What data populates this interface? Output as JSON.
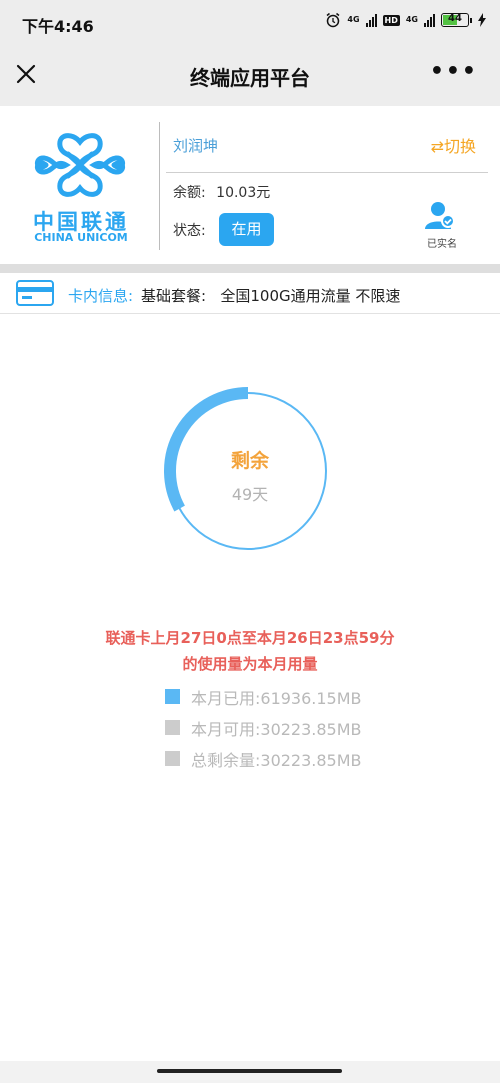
{
  "status_bar": {
    "time": "下午4:46",
    "network_1": "4G",
    "network_2": "HD",
    "network_3": "4G",
    "battery": "44"
  },
  "nav": {
    "title": "终端应用平台",
    "close_icon": "close-icon",
    "more_icon": "more-icon"
  },
  "account": {
    "logo_text_cn": "中国联通",
    "logo_text_en": "CHINA UNICOM",
    "name": "刘润坤",
    "switch_label": "⇄切换",
    "balance_label": "余额:",
    "balance_value": "10.03元",
    "status_label": "状态:",
    "status_value": "在用",
    "verified_label": "已实名"
  },
  "card_info": {
    "label": "卡内信息:",
    "value": "基础套餐:   全国100G通用流量 不限速"
  },
  "usage": {
    "ring_title": "剩余",
    "ring_days": "49天",
    "remaining_fraction": 0.33,
    "note_line1": "联通卡上月27日0点至本月26日23点59分",
    "note_line2": "的使用量为本月用量",
    "legend": [
      {
        "text": "本月已用:61936.15MB",
        "color": "#5ab8f4"
      },
      {
        "text": "本月可用:30223.85MB",
        "color": "#cccccc"
      },
      {
        "text": "总剩余量:30223.85MB",
        "color": "#cccccc"
      }
    ]
  },
  "colors": {
    "accent_blue": "#2ba6f0",
    "accent_orange": "#f3a33b",
    "note_red": "#e8605a"
  }
}
